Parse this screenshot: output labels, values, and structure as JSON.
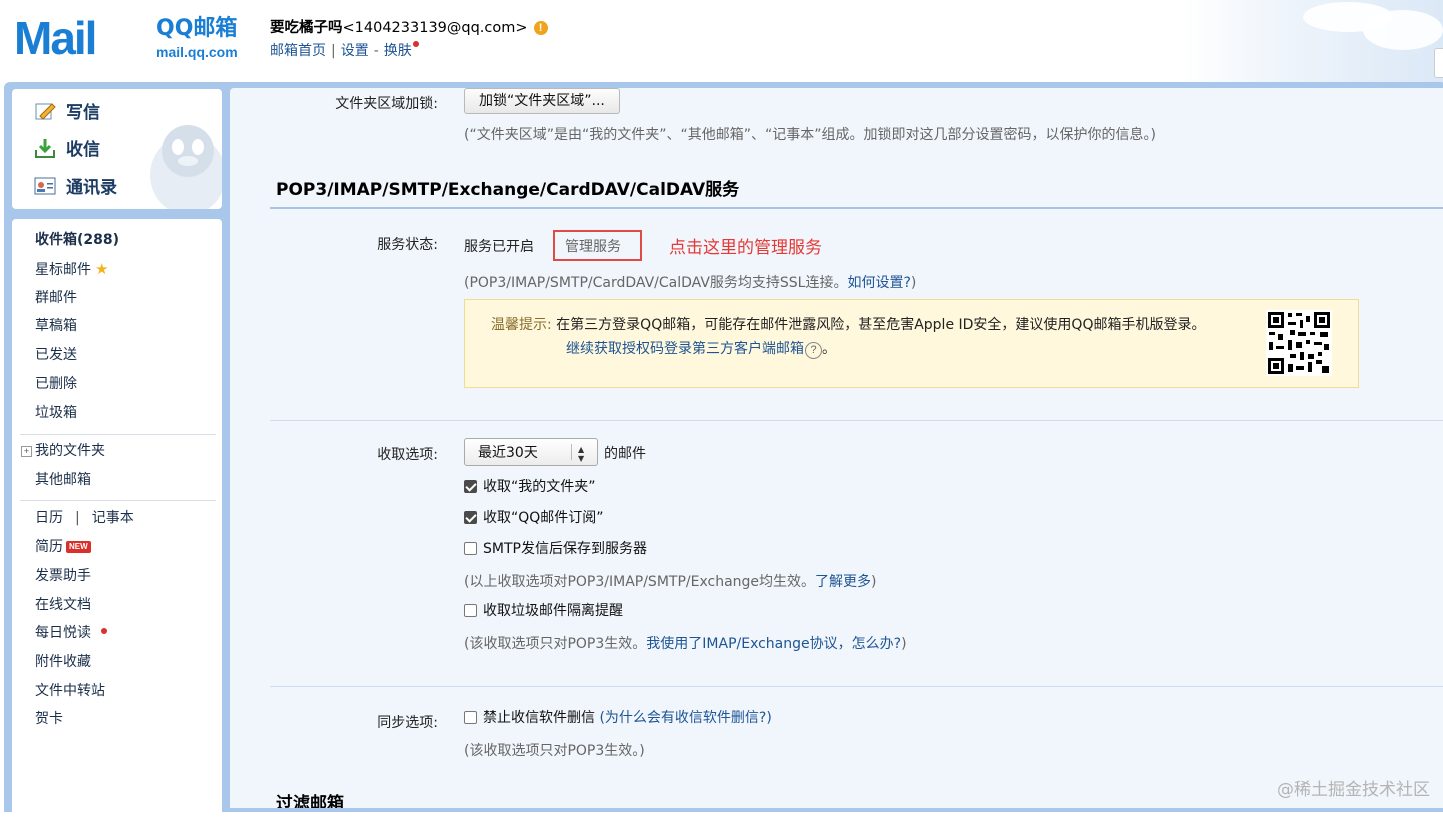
{
  "header": {
    "logo_text": "Mail",
    "logo_title": "QQ邮箱",
    "logo_domain": "mail.qq.com",
    "user_name": "要吃橘子吗",
    "user_email": "<1404233139@qq.com>",
    "links": {
      "home": "邮箱首页",
      "sep": "|",
      "settings": "设置",
      "dash": "-",
      "skin": "换肤"
    }
  },
  "sidebar": {
    "actions": {
      "compose": "写信",
      "inbox": "收信",
      "contacts": "通讯录"
    },
    "folders": {
      "inbox": "收件箱(288)",
      "starred": "星标邮件",
      "group": "群邮件",
      "drafts": "草稿箱",
      "sent": "已发送",
      "deleted": "已删除",
      "spam": "垃圾箱",
      "my_folders": "我的文件夹",
      "other_mailboxes": "其他邮箱"
    },
    "tools": {
      "calendar": "日历",
      "sep": "|",
      "notes": "记事本",
      "resume": "简历",
      "resume_badge": "NEW",
      "invoice": "发票助手",
      "docs": "在线文档",
      "daily_read": "每日悦读",
      "attachments": "附件收藏",
      "transfer": "文件中转站",
      "card": "贺卡"
    }
  },
  "main": {
    "folder_lock": {
      "label": "文件夹区域加锁:",
      "button": "加锁“文件夹区域”...",
      "hint": "(“文件夹区域”是由“我的文件夹”、“其他邮箱”、“记事本”组成。加锁即对这几部分设置密码，以保护你的信息。)"
    },
    "service_section": {
      "title": "POP3/IMAP/SMTP/Exchange/CardDAV/CalDAV服务",
      "status_label": "服务状态:",
      "status_value": "服务已开启",
      "manage_link": "管理服务",
      "annotation": "点击这里的管理服务",
      "ssl_hint": "(POP3/IMAP/SMTP/CardDAV/CalDAV服务均支持SSL连接。",
      "ssl_link": "如何设置?",
      "ssl_hint_end": ")",
      "tip_label": "温馨提示:",
      "tip_text": "在第三方登录QQ邮箱，可能存在邮件泄露风险，甚至危害Apple ID安全，建议使用QQ邮箱手机版登录。",
      "tip_link": "继续获取授权码登录第三方客户端邮箱",
      "tip_help": "?",
      "tip_end": "。"
    },
    "fetch_options": {
      "label": "收取选项:",
      "select_value": "最近30天",
      "select_suffix": "的邮件",
      "opt_my_folders": "收取“我的文件夹”",
      "opt_subscriptions": "收取“QQ邮件订阅”",
      "opt_smtp_save": "SMTP发信后保存到服务器",
      "hint1": "(以上收取选项对POP3/IMAP/SMTP/Exchange均生效。",
      "hint1_link": "了解更多",
      "hint1_end": ")",
      "opt_spam_alert": "收取垃圾邮件隔离提醒",
      "hint2": "(该收取选项只对POP3生效。",
      "hint2_link": "我使用了IMAP/Exchange协议，怎么办?",
      "hint2_end": ")"
    },
    "sync_options": {
      "label": "同步选项:",
      "opt_no_delete": "禁止收信软件删信",
      "link": "(为什么会有收信软件删信?)",
      "hint": "(该收取选项只对POP3生效。)"
    },
    "next_section": "过滤邮箱"
  },
  "checkboxes": {
    "my_folders": true,
    "subscriptions": true,
    "smtp_save": false,
    "spam_alert": false,
    "no_delete": false
  },
  "watermark": "@稀土掘金技术社区",
  "colors": {
    "brand": "#1a7fd4",
    "link": "#1e5494",
    "annotation": "#e53935",
    "tip_bg": "#fff8dd"
  }
}
